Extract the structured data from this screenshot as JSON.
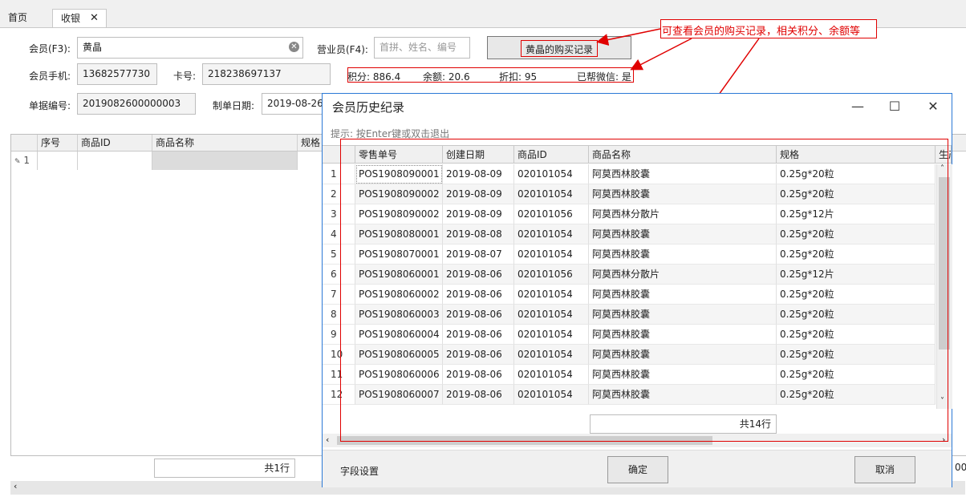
{
  "tabs": {
    "home": "首页",
    "active": "收银",
    "close": "✕"
  },
  "member": {
    "label": "会员(F3):",
    "value": "黄晶",
    "sales_label": "营业员(F4):",
    "sales_placeholder": "首拼、姓名、编号",
    "history_button": "黄晶的购买记录",
    "phone_label": "会员手机:",
    "phone": "13682577730",
    "card_label": "卡号:",
    "card": "218238697137",
    "points": "积分: 886.4",
    "balance": "余额: 20.6",
    "discount": "折扣: 95",
    "wechat": "已帮微信: 是",
    "docno_label": "单据编号:",
    "docno": "2019082600000003",
    "date_label": "制单日期:",
    "date": "2019-08-26"
  },
  "annotation": "可查看会员的购买记录，相关积分、余额等",
  "main_grid": {
    "headers": [
      "序号",
      "商品ID",
      "商品名称",
      "规格"
    ],
    "row_indicator": "1",
    "footer_count": "共1行",
    "right_clip": "00"
  },
  "dialog": {
    "title": "会员历史纪录",
    "controls": {
      "minimize": "—",
      "maximize": "☐",
      "close": "✕"
    },
    "hint": "提示: 按Enter键或双击退出",
    "headers": [
      "零售单号",
      "创建日期",
      "商品ID",
      "商品名称",
      "规格",
      "生产"
    ],
    "rows": [
      {
        "n": "1",
        "no": "POS1908090001",
        "date": "2019-08-09",
        "id": "020101054",
        "name": "阿莫西林胶囊",
        "spec": "0.25g*20粒"
      },
      {
        "n": "2",
        "no": "POS1908090002",
        "date": "2019-08-09",
        "id": "020101054",
        "name": "阿莫西林胶囊",
        "spec": "0.25g*20粒"
      },
      {
        "n": "3",
        "no": "POS1908090002",
        "date": "2019-08-09",
        "id": "020101056",
        "name": "阿莫西林分散片",
        "spec": "0.25g*12片"
      },
      {
        "n": "4",
        "no": "POS1908080001",
        "date": "2019-08-08",
        "id": "020101054",
        "name": "阿莫西林胶囊",
        "spec": "0.25g*20粒"
      },
      {
        "n": "5",
        "no": "POS1908070001",
        "date": "2019-08-07",
        "id": "020101054",
        "name": "阿莫西林胶囊",
        "spec": "0.25g*20粒"
      },
      {
        "n": "6",
        "no": "POS1908060001",
        "date": "2019-08-06",
        "id": "020101056",
        "name": "阿莫西林分散片",
        "spec": "0.25g*12片"
      },
      {
        "n": "7",
        "no": "POS1908060002",
        "date": "2019-08-06",
        "id": "020101054",
        "name": "阿莫西林胶囊",
        "spec": "0.25g*20粒"
      },
      {
        "n": "8",
        "no": "POS1908060003",
        "date": "2019-08-06",
        "id": "020101054",
        "name": "阿莫西林胶囊",
        "spec": "0.25g*20粒"
      },
      {
        "n": "9",
        "no": "POS1908060004",
        "date": "2019-08-06",
        "id": "020101054",
        "name": "阿莫西林胶囊",
        "spec": "0.25g*20粒"
      },
      {
        "n": "10",
        "no": "POS1908060005",
        "date": "2019-08-06",
        "id": "020101054",
        "name": "阿莫西林胶囊",
        "spec": "0.25g*20粒"
      },
      {
        "n": "11",
        "no": "POS1908060006",
        "date": "2019-08-06",
        "id": "020101054",
        "name": "阿莫西林胶囊",
        "spec": "0.25g*20粒"
      },
      {
        "n": "12",
        "no": "POS1908060007",
        "date": "2019-08-06",
        "id": "020101054",
        "name": "阿莫西林胶囊",
        "spec": "0.25g*20粒"
      }
    ],
    "count": "共14行",
    "field_settings": "字段设置",
    "ok": "确定",
    "cancel": "取消"
  },
  "colors": {
    "annotation_red": "#e00000",
    "dialog_border": "#2b79d6"
  }
}
